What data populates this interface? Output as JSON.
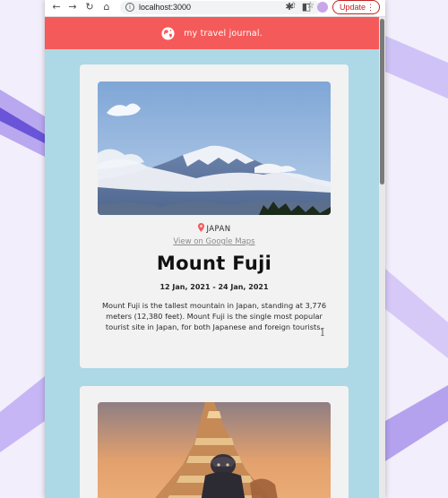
{
  "browser": {
    "url": "localhost:3000",
    "update_label": "Update",
    "icons": [
      "back-arrow-icon",
      "forward-arrow-icon",
      "reload-icon",
      "home-icon",
      "info-icon",
      "share-icon",
      "star-icon",
      "extensions-icon",
      "sidebar-icon",
      "profile-avatar",
      "menu-dots-icon"
    ]
  },
  "app": {
    "title": "my travel journal.",
    "header_color": "#f55a5a",
    "background_color": "#add8e6"
  },
  "entries": [
    {
      "location": "JAPAN",
      "maps_link": "View on Google Maps",
      "title": "Mount Fuji",
      "dates": "12 Jan, 2021 - 24 Jan, 2021",
      "description": "Mount Fuji is the tallest mountain in Japan, standing at 3,776 meters (12,380 feet). Mount Fuji is the single most popular tourist site in Japan, for both Japanese and foreign tourists."
    },
    {
      "image": "temple-statue-photo"
    }
  ]
}
